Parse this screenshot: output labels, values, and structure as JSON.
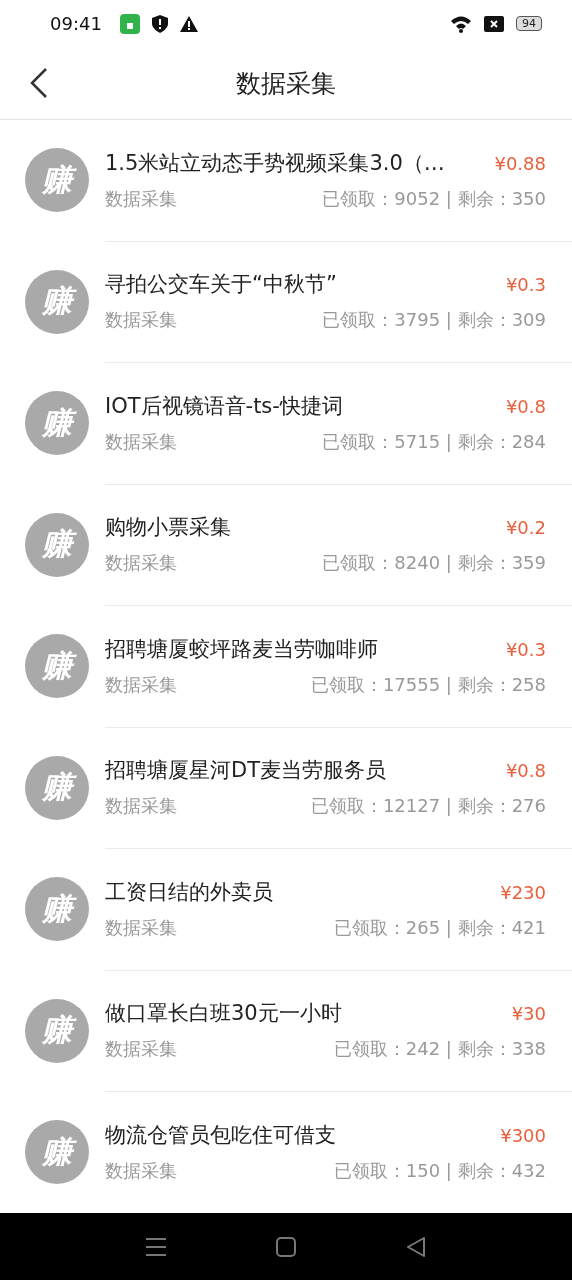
{
  "status_bar": {
    "time": "09:41",
    "battery": "94"
  },
  "header": {
    "title": "数据采集"
  },
  "tasks": [
    {
      "avatar": "赚",
      "title": "1.5米站立动态手势视频采集3.0（…",
      "price": "¥0.88",
      "category": "数据采集",
      "stats": "已领取：9052 | 剩余：350"
    },
    {
      "avatar": "赚",
      "title": "寻拍公交车关于“中秋节”",
      "price": "¥0.3",
      "category": "数据采集",
      "stats": "已领取：3795 | 剩余：309"
    },
    {
      "avatar": "赚",
      "title": "IOT后视镜语音-ts-快捷词",
      "price": "¥0.8",
      "category": "数据采集",
      "stats": "已领取：5715 | 剩余：284"
    },
    {
      "avatar": "赚",
      "title": "购物小票采集",
      "price": "¥0.2",
      "category": "数据采集",
      "stats": "已领取：8240 | 剩余：359"
    },
    {
      "avatar": "赚",
      "title": "招聘塘厦蛟坪路麦当劳咖啡师",
      "price": "¥0.3",
      "category": "数据采集",
      "stats": "已领取：17555 | 剩余：258"
    },
    {
      "avatar": "赚",
      "title": "招聘塘厦星河DT麦当劳服务员",
      "price": "¥0.8",
      "category": "数据采集",
      "stats": "已领取：12127 | 剩余：276"
    },
    {
      "avatar": "赚",
      "title": "工资日结的外卖员",
      "price": "¥230",
      "category": "数据采集",
      "stats": "已领取：265 | 剩余：421"
    },
    {
      "avatar": "赚",
      "title": "做口罩长白班30元一小时",
      "price": "¥30",
      "category": "数据采集",
      "stats": "已领取：242 | 剩余：338"
    },
    {
      "avatar": "赚",
      "title": "物流仓管员包吃住可借支",
      "price": "¥300",
      "category": "数据采集",
      "stats": "已领取：150 | 剩余：432"
    }
  ]
}
